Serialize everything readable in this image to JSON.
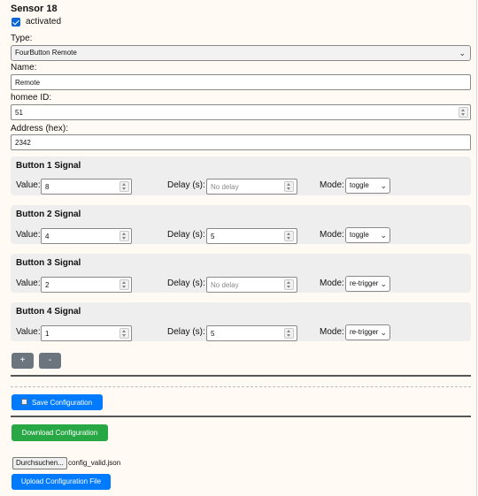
{
  "sensor": {
    "title": "Sensor 18",
    "activated_label": "activated",
    "activated": true,
    "type_label": "Type:",
    "type_value": "FourButton Remote",
    "name_label": "Name:",
    "name_value": "Remote",
    "homee_label": "homee ID:",
    "homee_value": "51",
    "address_label": "Address (hex):",
    "address_value": "2342"
  },
  "labels": {
    "value": "Value:",
    "delay": "Delay (s):",
    "mode": "Mode:",
    "delay_placeholder": "No delay"
  },
  "signals": [
    {
      "title": "Button 1 Signal",
      "value": "8",
      "delay": "",
      "mode": "toggle"
    },
    {
      "title": "Button 2 Signal",
      "value": "4",
      "delay": "5",
      "mode": "toggle"
    },
    {
      "title": "Button 3 Signal",
      "value": "2",
      "delay": "",
      "mode": "re-trigger"
    },
    {
      "title": "Button 4 Signal",
      "value": "1",
      "delay": "5",
      "mode": "re-trigger"
    }
  ],
  "actions": {
    "add_label": "+",
    "remove_label": "-",
    "save_label": "Save Configuration",
    "save_icon": "floppy-disk-icon",
    "download_label": "Download Configuration",
    "browse_label": "Durchsuchen...",
    "file_name": "config_valid.json",
    "upload_label": "Upload Configuration File"
  },
  "colors": {
    "primary": "#007bff",
    "success": "#28a745",
    "secondary": "#6c757d",
    "panel_bg": "#fffaf3",
    "signal_bg": "#eeeeee"
  }
}
